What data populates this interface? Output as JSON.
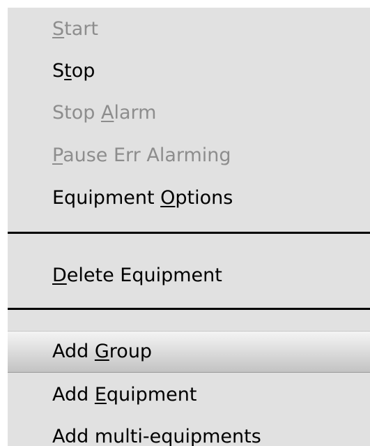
{
  "menu": {
    "items": [
      {
        "pre": "",
        "mnemonic": "S",
        "post": "tart",
        "enabled": false
      },
      {
        "pre": "S",
        "mnemonic": "t",
        "post": "op",
        "enabled": true
      },
      {
        "pre": "Stop ",
        "mnemonic": "A",
        "post": "larm",
        "enabled": false
      },
      {
        "pre": "",
        "mnemonic": "P",
        "post": "ause Err Alarming",
        "enabled": false
      },
      {
        "pre": "Equipment ",
        "mnemonic": "O",
        "post": "ptions",
        "enabled": true
      },
      {
        "pre": "",
        "mnemonic": "D",
        "post": "elete Equipment",
        "enabled": true
      },
      {
        "pre": "Add ",
        "mnemonic": "G",
        "post": "roup",
        "enabled": true,
        "hovered": true
      },
      {
        "pre": "Add ",
        "mnemonic": "E",
        "post": "quipment",
        "enabled": true
      },
      {
        "pre": "Add multi-equipments",
        "mnemonic": "",
        "post": "",
        "enabled": true
      }
    ]
  }
}
